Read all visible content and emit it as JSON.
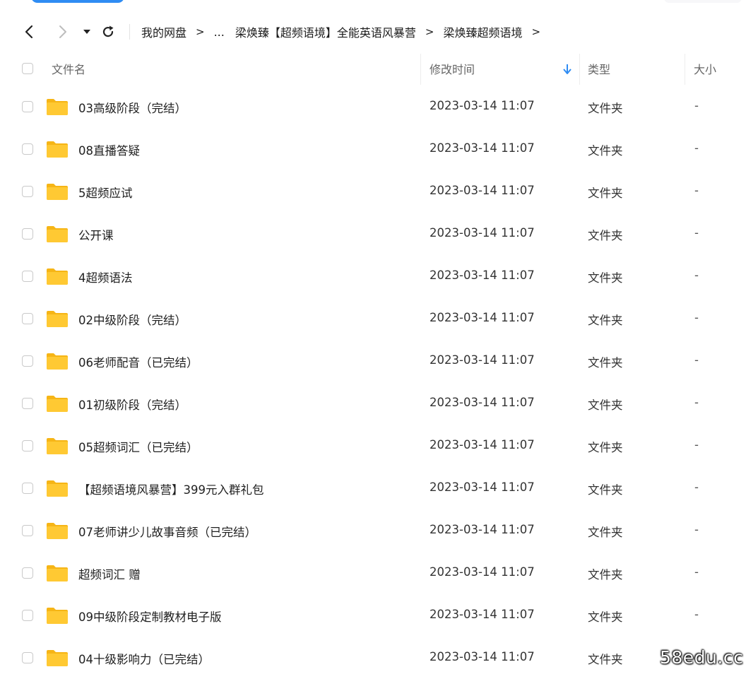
{
  "toolbar": {
    "breadcrumb": [
      "我的网盘",
      "...",
      "梁焕臻【超频语境】全能英语风暴营",
      "梁焕臻超频语境"
    ],
    "separator": ">"
  },
  "columns": {
    "name": "文件名",
    "modified": "修改时间",
    "type": "类型",
    "size": "大小",
    "sort_icon": "arrow-down-icon"
  },
  "files": [
    {
      "name": "03高级阶段（完结）",
      "modified": "2023-03-14 11:07",
      "type": "文件夹",
      "size": "-"
    },
    {
      "name": "08直播答疑",
      "modified": "2023-03-14 11:07",
      "type": "文件夹",
      "size": "-"
    },
    {
      "name": "5超频应试",
      "modified": "2023-03-14 11:07",
      "type": "文件夹",
      "size": "-"
    },
    {
      "name": "公开课",
      "modified": "2023-03-14 11:07",
      "type": "文件夹",
      "size": "-"
    },
    {
      "name": "4超频语法",
      "modified": "2023-03-14 11:07",
      "type": "文件夹",
      "size": "-"
    },
    {
      "name": "02中级阶段（完结）",
      "modified": "2023-03-14 11:07",
      "type": "文件夹",
      "size": "-"
    },
    {
      "name": "06老师配音（已完结）",
      "modified": "2023-03-14 11:07",
      "type": "文件夹",
      "size": "-"
    },
    {
      "name": "01初级阶段（完结）",
      "modified": "2023-03-14 11:07",
      "type": "文件夹",
      "size": "-"
    },
    {
      "name": "05超频词汇（已完结）",
      "modified": "2023-03-14 11:07",
      "type": "文件夹",
      "size": "-"
    },
    {
      "name": "【超频语境风暴营】399元入群礼包",
      "modified": "2023-03-14 11:07",
      "type": "文件夹",
      "size": "-"
    },
    {
      "name": "07老师讲少儿故事音频（已完结）",
      "modified": "2023-03-14 11:07",
      "type": "文件夹",
      "size": "-"
    },
    {
      "name": "超频词汇 赠",
      "modified": "2023-03-14 11:07",
      "type": "文件夹",
      "size": "-"
    },
    {
      "name": "09中级阶段定制教材电子版",
      "modified": "2023-03-14 11:07",
      "type": "文件夹",
      "size": "-"
    },
    {
      "name": "04十级影响力（已完结）",
      "modified": "2023-03-14 11:07",
      "type": "文件夹",
      "size": "-"
    }
  ],
  "watermark": "58edu.cc",
  "colors": {
    "accent": "#2f8cf3",
    "folder": "#ffc933",
    "folder_back": "#f6b516"
  }
}
